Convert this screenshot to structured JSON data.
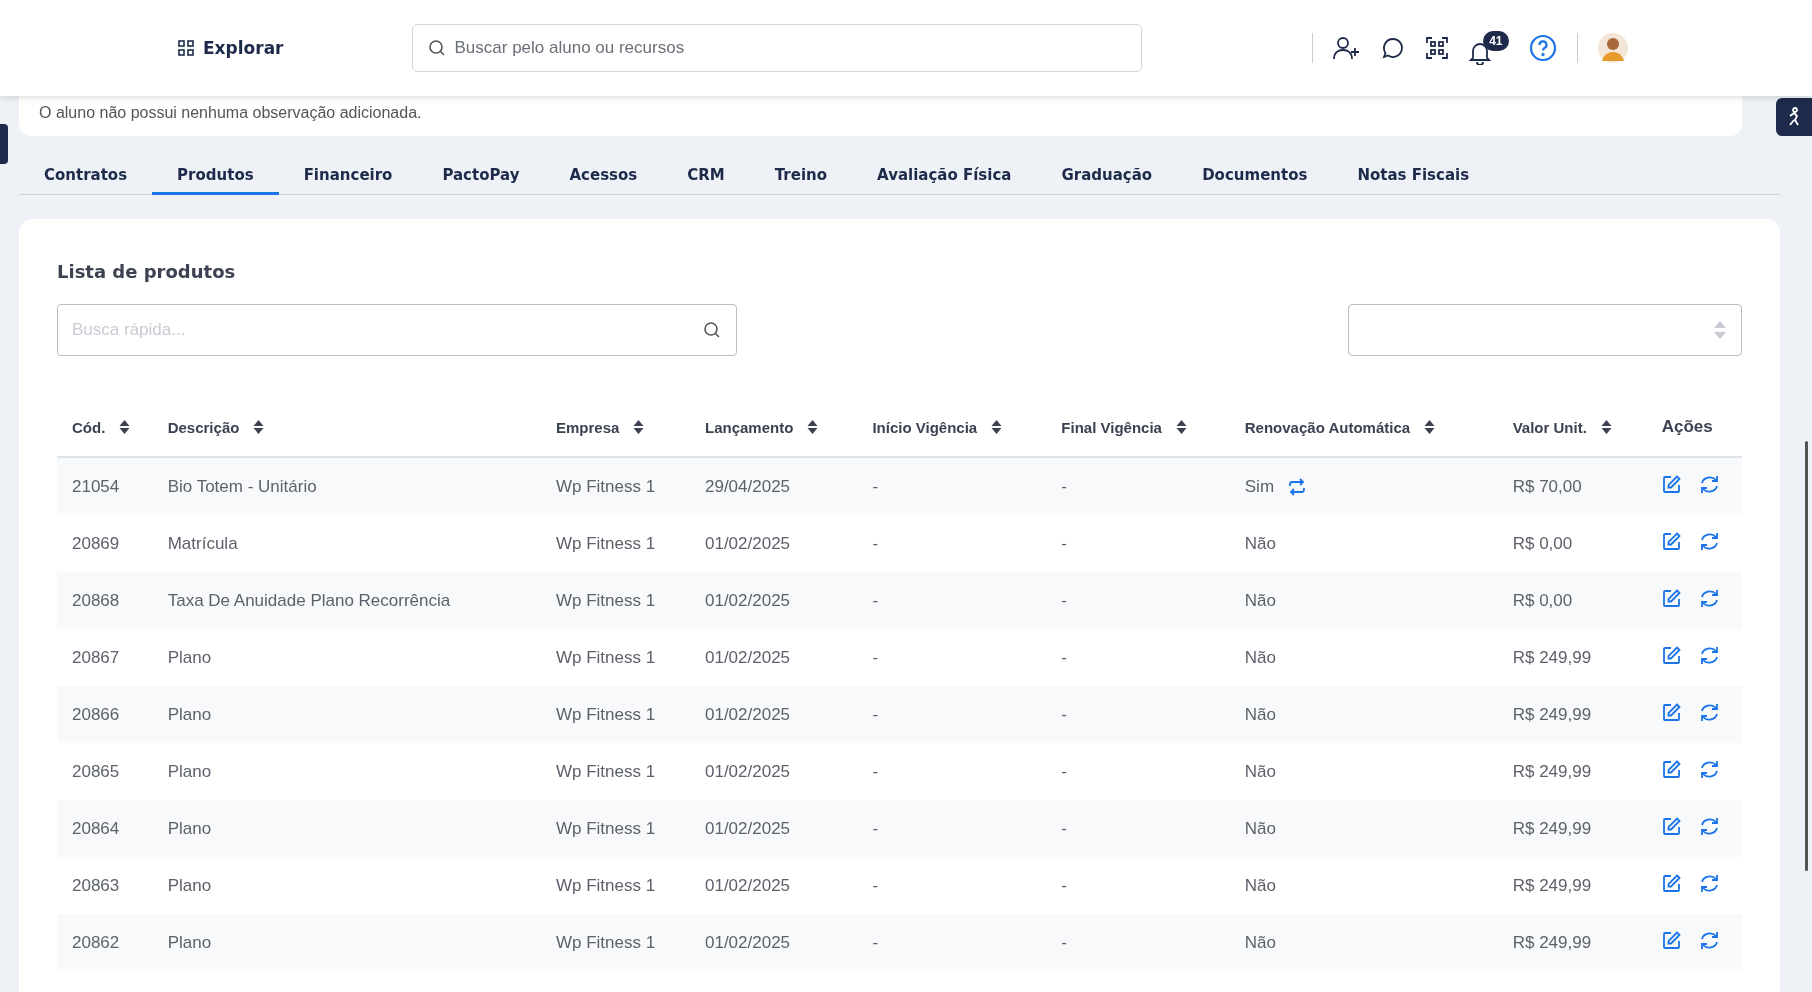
{
  "header": {
    "explore_label": "Explorar",
    "search": {
      "placeholder": "Buscar pelo aluno ou recursos"
    },
    "notification_count": "41"
  },
  "observation": "O aluno não possui nenhuma observação adicionada.",
  "tabs": [
    {
      "label": "Contratos",
      "selected": false
    },
    {
      "label": "Produtos",
      "selected": true
    },
    {
      "label": "Financeiro",
      "selected": false
    },
    {
      "label": "PactoPay",
      "selected": false
    },
    {
      "label": "Acessos",
      "selected": false
    },
    {
      "label": "CRM",
      "selected": false
    },
    {
      "label": "Treino",
      "selected": false
    },
    {
      "label": "Avaliação Física",
      "selected": false
    },
    {
      "label": "Graduação",
      "selected": false
    },
    {
      "label": "Documentos",
      "selected": false
    },
    {
      "label": "Notas Fiscais",
      "selected": false
    }
  ],
  "panel": {
    "title": "Lista de produtos",
    "search": {
      "placeholder": "Busca rápida..."
    }
  },
  "table": {
    "columns": [
      "Cód.",
      "Descrição",
      "Empresa",
      "Lançamento",
      "Início Vigência",
      "Final Vigência",
      "Renovação Automática",
      "Valor Unit.",
      "Ações"
    ],
    "rows": [
      {
        "code": "21054",
        "description": "Bio Totem - Unitário",
        "company": "Wp Fitness 1",
        "date": "29/04/2025",
        "start": "-",
        "end": "-",
        "renewal": "Sim",
        "auto_renew": true,
        "value": "R$ 70,00"
      },
      {
        "code": "20869",
        "description": "Matrícula",
        "company": "Wp Fitness 1",
        "date": "01/02/2025",
        "start": "-",
        "end": "-",
        "renewal": "Não",
        "auto_renew": false,
        "value": "R$ 0,00"
      },
      {
        "code": "20868",
        "description": "Taxa De Anuidade Plano Recorrência",
        "company": "Wp Fitness 1",
        "date": "01/02/2025",
        "start": "-",
        "end": "-",
        "renewal": "Não",
        "auto_renew": false,
        "value": "R$ 0,00"
      },
      {
        "code": "20867",
        "description": "Plano",
        "company": "Wp Fitness 1",
        "date": "01/02/2025",
        "start": "-",
        "end": "-",
        "renewal": "Não",
        "auto_renew": false,
        "value": "R$ 249,99"
      },
      {
        "code": "20866",
        "description": "Plano",
        "company": "Wp Fitness 1",
        "date": "01/02/2025",
        "start": "-",
        "end": "-",
        "renewal": "Não",
        "auto_renew": false,
        "value": "R$ 249,99"
      },
      {
        "code": "20865",
        "description": "Plano",
        "company": "Wp Fitness 1",
        "date": "01/02/2025",
        "start": "-",
        "end": "-",
        "renewal": "Não",
        "auto_renew": false,
        "value": "R$ 249,99"
      },
      {
        "code": "20864",
        "description": "Plano",
        "company": "Wp Fitness 1",
        "date": "01/02/2025",
        "start": "-",
        "end": "-",
        "renewal": "Não",
        "auto_renew": false,
        "value": "R$ 249,99"
      },
      {
        "code": "20863",
        "description": "Plano",
        "company": "Wp Fitness 1",
        "date": "01/02/2025",
        "start": "-",
        "end": "-",
        "renewal": "Não",
        "auto_renew": false,
        "value": "R$ 249,99"
      },
      {
        "code": "20862",
        "description": "Plano",
        "company": "Wp Fitness 1",
        "date": "01/02/2025",
        "start": "-",
        "end": "-",
        "renewal": "Não",
        "auto_renew": false,
        "value": "R$ 249,99"
      }
    ]
  }
}
